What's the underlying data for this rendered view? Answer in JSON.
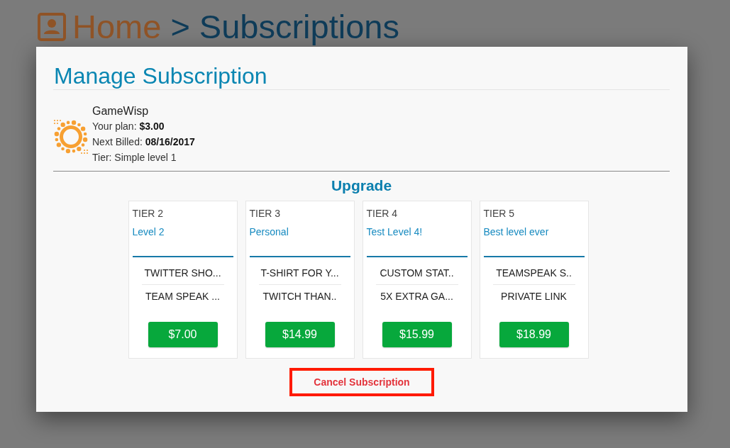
{
  "breadcrumb": {
    "home": "Home",
    "separator": ">",
    "current": "Subscriptions"
  },
  "modal": {
    "title": "Manage Subscription",
    "subscription": {
      "name": "GameWisp",
      "details": [
        "Your plan: **$3.00**",
        "Next Billed: **08/16/2017**",
        "Tier: Simple level 1"
      ]
    },
    "upgrade": {
      "heading": "Upgrade",
      "tiers": [
        {
          "tier": "TIER 2",
          "name": "Level 2",
          "features": [
            "TWITTER SHO...",
            "TEAM SPEAK ..."
          ],
          "price": "$7.00"
        },
        {
          "tier": "TIER 3",
          "name": "Personal",
          "features": [
            "T-SHIRT FOR Y...",
            "TWITCH THAN.."
          ],
          "price": "$14.99"
        },
        {
          "tier": "TIER 4",
          "name": "Test Level 4!",
          "features": [
            "CUSTOM STAT..",
            "5X EXTRA GA..."
          ],
          "price": "$15.99"
        },
        {
          "tier": "TIER 5",
          "name": "Best level ever",
          "features": [
            "TEAMSPEAK S..",
            "PRIVATE LINK"
          ],
          "price": "$18.99"
        }
      ]
    },
    "cancel_button": "Cancel Subscription"
  }
}
